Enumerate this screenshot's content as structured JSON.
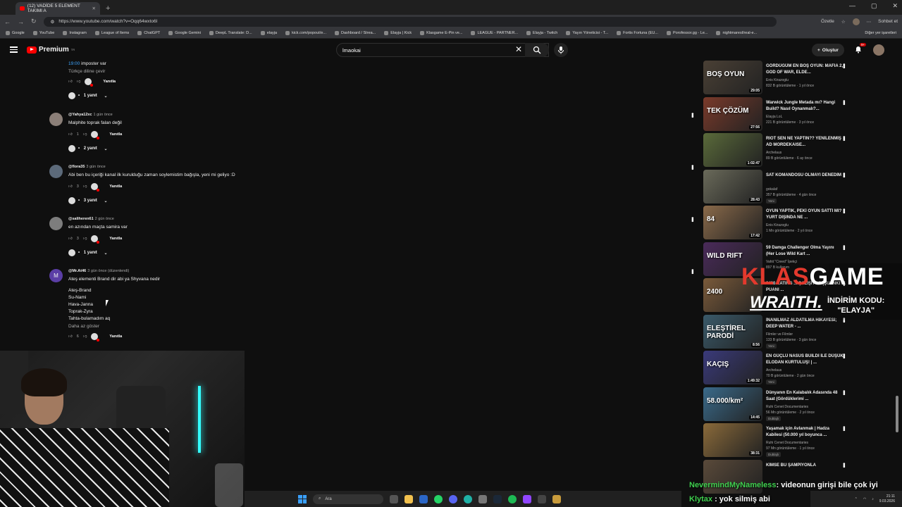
{
  "browser": {
    "tab_title": "(12) VADİDE 5 ELEMENT TAKIMI A",
    "url": "https://www.youtube.com/watch?v=Oqq64wxto6I",
    "right_label": "Özetle",
    "profile_label": "Sohbet et",
    "bookmarks": [
      "Google",
      "YouTube",
      "Instagram",
      "League of Items",
      "ChatGPT",
      "Google Gemini",
      "DeepL Translate: D...",
      "elayja",
      "kick.com/popout/e...",
      "Dashboard / Strea...",
      "Elayja | Kick",
      "Klasgame E-Pin ve...",
      "LEAGUE - PARTNER...",
      "Elayja - Twitch",
      "Yayın Yöneticisi - T...",
      "Fortis Fortuna (EU...",
      "Porofessor.gg - Le...",
      "nightmaresl/real-e..."
    ],
    "other_bookmarks": "Diğer yer işaretleri"
  },
  "yt": {
    "logo": "Premium",
    "logo_sup": "TR",
    "search_value": "lmaokai",
    "create_label": "Oluştur",
    "notif_count": "9+"
  },
  "comments": [
    {
      "handle": "",
      "time": "",
      "link": "19:00",
      "text": " imposter var",
      "translate": "Türkçe diline çevir",
      "likes": "",
      "reply_label": "Yanıtla",
      "replies": "1 yanıt"
    },
    {
      "handle": "@Yahya12xc",
      "time": "1 gün önce",
      "text": "Malphite toprak falan değil",
      "likes": "1",
      "reply_label": "Yanıtla",
      "replies": "2 yanıt"
    },
    {
      "handle": "@flora35",
      "time": "3 gün önce",
      "text": "Abi ben bu içeriği kanal ilk kurulduğu zaman soylemistim bağışla, yeni mi geliyo :D",
      "likes": "3",
      "reply_label": "Yanıtla",
      "replies": "3 yanıt"
    },
    {
      "handle": "@saliheren61",
      "time": "2 gün önce",
      "text": "en azından maçta samira var",
      "likes": "3",
      "reply_label": "Yanıtla",
      "replies": "1 yanıt"
    },
    {
      "handle": "@Mr.At46",
      "time": "3 gün önce (düzenlendi)",
      "text": "Ateş elementi Brand dir abi ya Shyvana nedir",
      "lines": [
        "Ateş-Brand",
        "Su-Nami",
        "Hava-Janna",
        "Toprak-Zyra",
        "Tahta-bulamadım aq"
      ],
      "more": "Daha az göster",
      "likes": "6",
      "reply_label": "Yanıtla",
      "avatar_letter": "M"
    }
  ],
  "videos": [
    {
      "title": "GÖRDÜĞÜM EN BOŞ OYUN: MAFIA 2, GOD OF WAR, ELDE...",
      "channel": "Enis Kirazoglu",
      "meta": "832 B görüntüleme · 1 yıl önce",
      "duration": "29:05",
      "caption": "BOŞ OYUN",
      "badge": ""
    },
    {
      "title": "Warwick Jungle Metada mı? Hangi Build? Nasıl Oynanmalı?...",
      "channel": "Elayja LoL",
      "meta": "221 B görüntüleme · 3 yıl önce",
      "duration": "27:56",
      "caption": "TEK ÇÖZÜM",
      "badge": ""
    },
    {
      "title": "RIOT SEN NE YAPTIN?? YENİLENMİŞ AD MORDEKAISE...",
      "channel": "Archelaus",
      "meta": "89 B görüntüleme · 6 ay önce",
      "duration": "1:02:47",
      "caption": "",
      "badge": ""
    },
    {
      "title": "SAT KOMANDOSU OLMAYI DENEDİM",
      "channel": "gokalaf",
      "meta": "357 B görüntüleme · 4 gün önce",
      "duration": "28:43",
      "caption": "",
      "badge": "Yeni"
    },
    {
      "title": "OYUN YAPTIK, PEKİ OYUN SATTI MI? YURT DIŞINDA NE ...",
      "channel": "Enis Kirazoglu",
      "meta": "1 Mn görüntüleme · 2 yıl önce",
      "duration": "17:42",
      "caption": "84",
      "badge": ""
    },
    {
      "title": "59 Damga Challenger Olma Yayını (Her Lose Wild Kart ...",
      "channel": "Vahit \"Creed\" İpekçi",
      "meta": "897 B kullanım",
      "duration": "",
      "caption": "WILD RIFT",
      "badge": ""
    },
    {
      "title": "2400 RATING ... ÇALIŞIYOR (ŞUANKİ PUANI ...",
      "channel": "",
      "meta": "",
      "duration": "",
      "caption": "2400",
      "badge": ""
    },
    {
      "title": "İNANILMAZ ALDATILMA HİKAYESİ; DEEP WATER - ...",
      "channel": "Filmler ve Filmler",
      "meta": "133 B görüntüleme · 3 gün önce",
      "duration": "8:56",
      "caption": "ELEŞTİREL PARODİ",
      "badge": "Yeni"
    },
    {
      "title": "EN GÜÇLÜ NASUS BUILDİ İLE DÜŞÜK ELODAN KURTULUŞ! | ...",
      "channel": "Archelaus",
      "meta": "70 B görüntüleme · 2 gün önce",
      "duration": "1:49:32",
      "caption": "KAÇIŞ",
      "badge": "Yeni"
    },
    {
      "title": "Dünyanın En Kalabalık Adasında 48 Saat (Gördüklerimi ...",
      "channel": "Ruhi Cenet Documentaries",
      "meta": "56 Mn görüntüleme · 2 yıl önce",
      "duration": "14:45",
      "caption": "58.000/km²",
      "badge": "Dublajlı"
    },
    {
      "title": "Yaşamak için Avlanmak | Hadza Kabilesi (50.000 yıl boyunca ...",
      "channel": "Ruhi Cenet Documentaries",
      "meta": "97 Mn görüntüleme · 1 yıl önce",
      "duration": "38:31",
      "caption": "",
      "badge": "Dublajlı"
    },
    {
      "title": "KİMSE BU ŞAMPİYONLA",
      "channel": "",
      "meta": "",
      "duration": "",
      "caption": "",
      "badge": ""
    }
  ],
  "overlay": {
    "klas_a": "KLAS",
    "klas_b": "GAME",
    "wraith": "WRAITH.",
    "code_label": "İNDİRİM KODU:",
    "code": "\"ELAYJA\"",
    "chat1_user": "NevermindMyNameless",
    "chat1_text": ": videonun girişi bile çok iyi",
    "chat2_user": "Klytax",
    "chat2_text": " : yok silmiş abi"
  },
  "taskbar": {
    "search": "Ara",
    "time": "21:11",
    "date": "9.03.2026"
  },
  "colors": {
    "accent": "#3ea6ff",
    "brand": "#ff0000",
    "chat_user": "#3fd04f"
  }
}
